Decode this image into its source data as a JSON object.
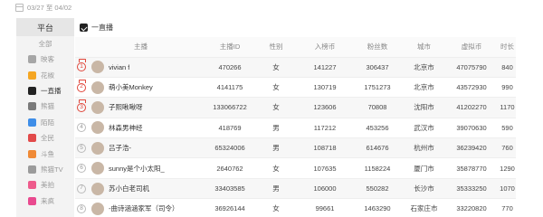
{
  "date_range": "03/27 至 04/02",
  "sidebar": {
    "header": "平台",
    "all_label": "全部",
    "items": [
      {
        "label": "映客",
        "color": "#a6a6a6"
      },
      {
        "label": "花椒",
        "color": "#f5a623"
      },
      {
        "label": "一直播",
        "color": "#222222"
      },
      {
        "label": "熊猫",
        "color": "#7a7a7a"
      },
      {
        "label": "陌陌",
        "color": "#3f8ee8"
      },
      {
        "label": "全民",
        "color": "#e24a4a"
      },
      {
        "label": "斗鱼",
        "color": "#f08a36"
      },
      {
        "label": "熊猫TV",
        "color": "#9b9b9b"
      },
      {
        "label": "美拍",
        "color": "#ee5b8c"
      },
      {
        "label": "来疯",
        "color": "#e94a8f"
      }
    ]
  },
  "platform_title": "一直播",
  "table": {
    "headers": [
      "主播",
      "主播ID",
      "性别",
      "入榜币",
      "粉丝数",
      "城市",
      "虚拟币",
      "时长"
    ],
    "rows": [
      {
        "rank": "1",
        "name": "vivian f",
        "id": "470266",
        "gender": "女",
        "coins": "141227",
        "fans": "306437",
        "city": "北京市",
        "virtual": "47075790",
        "duration": "840"
      },
      {
        "rank": "2",
        "name": "萌小美Monkey",
        "id": "4141175",
        "gender": "女",
        "coins": "130719",
        "fans": "1751273",
        "city": "北京市",
        "virtual": "43572930",
        "duration": "990"
      },
      {
        "rank": "3",
        "name": "子熙啾啾呀",
        "id": "133066722",
        "gender": "女",
        "coins": "123606",
        "fans": "70808",
        "city": "沈阳市",
        "virtual": "41202270",
        "duration": "1170"
      },
      {
        "rank": "4",
        "name": "林森男神经",
        "id": "418769",
        "gender": "男",
        "coins": "117212",
        "fans": "453256",
        "city": "武汉市",
        "virtual": "39070630",
        "duration": "590"
      },
      {
        "rank": "5",
        "name": "吕子浩-",
        "id": "65324006",
        "gender": "男",
        "coins": "108718",
        "fans": "614676",
        "city": "杭州市",
        "virtual": "36239420",
        "duration": "760"
      },
      {
        "rank": "6",
        "name": "sunny是个小太阳_",
        "id": "2640762",
        "gender": "女",
        "coins": "107635",
        "fans": "1158224",
        "city": "厦门市",
        "virtual": "35878770",
        "duration": "1290"
      },
      {
        "rank": "7",
        "name": "苏小白老司机",
        "id": "33403585",
        "gender": "男",
        "coins": "106000",
        "fans": "550282",
        "city": "长沙市",
        "virtual": "35333250",
        "duration": "1070"
      },
      {
        "rank": "8",
        "name": "-曲诗涵涵家军（司令）",
        "id": "36926144",
        "gender": "女",
        "coins": "99661",
        "fans": "1463290",
        "city": "石家庄市",
        "virtual": "33220820",
        "duration": "770"
      }
    ]
  }
}
